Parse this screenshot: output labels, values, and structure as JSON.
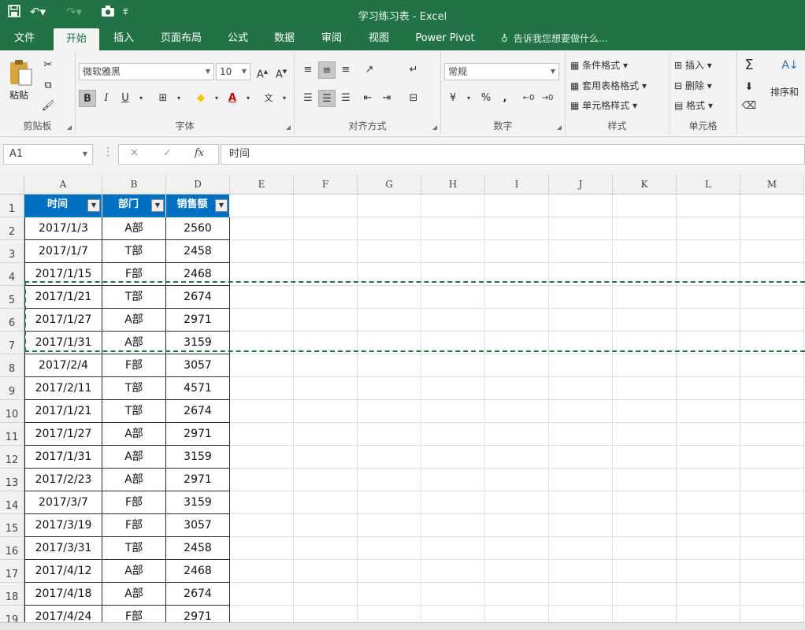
{
  "titlebar": {
    "title": "学习练习表 - Excel",
    "save_icon": "save-icon",
    "undo_icon": "undo-icon",
    "redo_icon": "redo-icon",
    "camera_icon": "camera-icon"
  },
  "tabs": [
    "文件",
    "开始",
    "插入",
    "页面布局",
    "公式",
    "数据",
    "审阅",
    "视图",
    "Power Pivot"
  ],
  "tell_me": "告诉我您想要做什么...",
  "ribbon": {
    "clipboard": {
      "paste": "粘贴",
      "label": "剪贴板"
    },
    "font": {
      "name": "微软雅黑",
      "size": "10",
      "bold": "B",
      "italic": "I",
      "underline": "U",
      "label": "字体"
    },
    "alignment": {
      "label": "对齐方式"
    },
    "number": {
      "format": "常规",
      "percent": "%",
      "comma": ",",
      "label": "数字"
    },
    "styles": {
      "conditional": "条件格式",
      "table": "套用表格格式",
      "cell": "单元格样式",
      "label": "样式"
    },
    "cells": {
      "insert": "插入",
      "delete": "删除",
      "format": "格式",
      "label": "单元格"
    },
    "editing": {
      "sort": "排序和"
    }
  },
  "formula_bar": {
    "name_box": "A1",
    "cancel": "✕",
    "enter": "✓",
    "fx": "fx",
    "content": "时间"
  },
  "sheet": {
    "columns": [
      "A",
      "B",
      "D",
      "E",
      "F",
      "G",
      "H",
      "I",
      "J",
      "K",
      "L",
      "M"
    ],
    "rows": [
      "1",
      "2",
      "3",
      "4",
      "5",
      "6",
      "7",
      "8",
      "9",
      "10",
      "11",
      "12",
      "13",
      "14",
      "15",
      "16",
      "17",
      "18",
      "19"
    ],
    "headers": [
      "时间",
      "部门",
      "销售额"
    ],
    "data": [
      [
        "2017/1/3",
        "A部",
        "2560"
      ],
      [
        "2017/1/7",
        "T部",
        "2458"
      ],
      [
        "2017/1/15",
        "F部",
        "2468"
      ],
      [
        "2017/1/21",
        "T部",
        "2674"
      ],
      [
        "2017/1/27",
        "A部",
        "2971"
      ],
      [
        "2017/1/31",
        "A部",
        "3159"
      ],
      [
        "2017/2/4",
        "F部",
        "3057"
      ],
      [
        "2017/2/11",
        "T部",
        "4571"
      ],
      [
        "2017/1/21",
        "T部",
        "2674"
      ],
      [
        "2017/1/27",
        "A部",
        "2971"
      ],
      [
        "2017/1/31",
        "A部",
        "3159"
      ],
      [
        "2017/2/23",
        "A部",
        "2971"
      ],
      [
        "2017/3/7",
        "F部",
        "3159"
      ],
      [
        "2017/3/19",
        "F部",
        "3057"
      ],
      [
        "2017/3/31",
        "T部",
        "2458"
      ],
      [
        "2017/4/12",
        "A部",
        "2468"
      ],
      [
        "2017/4/18",
        "A部",
        "2674"
      ],
      [
        "2017/4/24",
        "F部",
        "2971"
      ]
    ]
  },
  "colors": {
    "brand": "#217346",
    "table_header": "#0070c0"
  }
}
